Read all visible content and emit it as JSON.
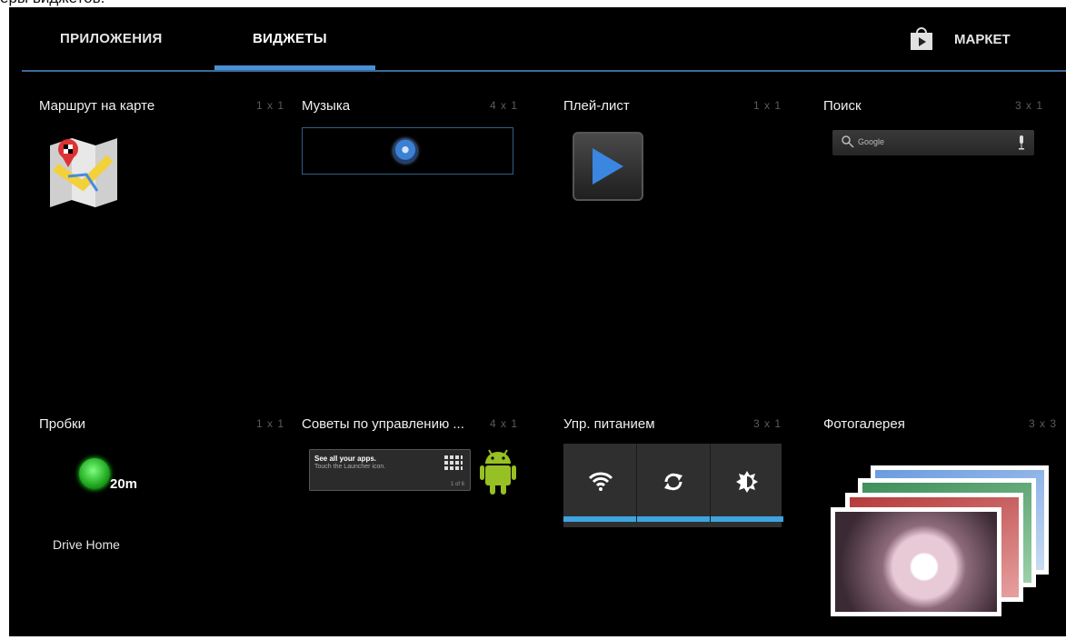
{
  "caption": "еры виджетов.",
  "tabs": {
    "apps": "ПРИЛОЖЕНИЯ",
    "widgets": "ВИДЖЕТЫ",
    "market": "МАРКЕТ"
  },
  "widgets": [
    {
      "title": "Маршрут на карте",
      "size": "1 x 1"
    },
    {
      "title": "Музыка",
      "size": "4 x 1"
    },
    {
      "title": "Плей-лист",
      "size": "1 x 1"
    },
    {
      "title": "Поиск",
      "size": "3 x 1",
      "search_text": "Google"
    },
    {
      "title": "Пробки",
      "size": "1 x 1",
      "eta": "20m",
      "label": "Drive Home"
    },
    {
      "title": "Советы по управлению ...",
      "size": "4 x 1",
      "tip_line1": "See all your apps.",
      "tip_line2": "Touch the Launcher icon.",
      "tip_page": "1 of 6"
    },
    {
      "title": "Упр. питанием",
      "size": "3 x 1"
    },
    {
      "title": "Фотогалерея",
      "size": "3 x 3"
    }
  ],
  "colors": {
    "accent": "#4a90d6",
    "power_indicator": "#3ea4e0"
  }
}
